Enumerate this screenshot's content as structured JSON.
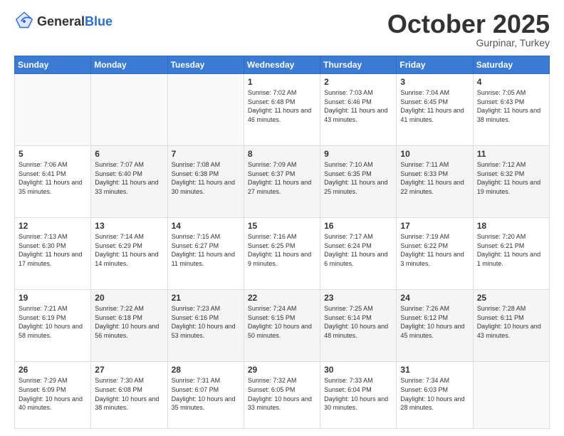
{
  "header": {
    "logo_general": "General",
    "logo_blue": "Blue",
    "month_title": "October 2025",
    "subtitle": "Gurpinar, Turkey"
  },
  "weekdays": [
    "Sunday",
    "Monday",
    "Tuesday",
    "Wednesday",
    "Thursday",
    "Friday",
    "Saturday"
  ],
  "weeks": [
    [
      {
        "day": "",
        "info": ""
      },
      {
        "day": "",
        "info": ""
      },
      {
        "day": "",
        "info": ""
      },
      {
        "day": "1",
        "info": "Sunrise: 7:02 AM\nSunset: 6:48 PM\nDaylight: 11 hours\nand 46 minutes."
      },
      {
        "day": "2",
        "info": "Sunrise: 7:03 AM\nSunset: 6:46 PM\nDaylight: 11 hours\nand 43 minutes."
      },
      {
        "day": "3",
        "info": "Sunrise: 7:04 AM\nSunset: 6:45 PM\nDaylight: 11 hours\nand 41 minutes."
      },
      {
        "day": "4",
        "info": "Sunrise: 7:05 AM\nSunset: 6:43 PM\nDaylight: 11 hours\nand 38 minutes."
      }
    ],
    [
      {
        "day": "5",
        "info": "Sunrise: 7:06 AM\nSunset: 6:41 PM\nDaylight: 11 hours\nand 35 minutes."
      },
      {
        "day": "6",
        "info": "Sunrise: 7:07 AM\nSunset: 6:40 PM\nDaylight: 11 hours\nand 33 minutes."
      },
      {
        "day": "7",
        "info": "Sunrise: 7:08 AM\nSunset: 6:38 PM\nDaylight: 11 hours\nand 30 minutes."
      },
      {
        "day": "8",
        "info": "Sunrise: 7:09 AM\nSunset: 6:37 PM\nDaylight: 11 hours\nand 27 minutes."
      },
      {
        "day": "9",
        "info": "Sunrise: 7:10 AM\nSunset: 6:35 PM\nDaylight: 11 hours\nand 25 minutes."
      },
      {
        "day": "10",
        "info": "Sunrise: 7:11 AM\nSunset: 6:33 PM\nDaylight: 11 hours\nand 22 minutes."
      },
      {
        "day": "11",
        "info": "Sunrise: 7:12 AM\nSunset: 6:32 PM\nDaylight: 11 hours\nand 19 minutes."
      }
    ],
    [
      {
        "day": "12",
        "info": "Sunrise: 7:13 AM\nSunset: 6:30 PM\nDaylight: 11 hours\nand 17 minutes."
      },
      {
        "day": "13",
        "info": "Sunrise: 7:14 AM\nSunset: 6:29 PM\nDaylight: 11 hours\nand 14 minutes."
      },
      {
        "day": "14",
        "info": "Sunrise: 7:15 AM\nSunset: 6:27 PM\nDaylight: 11 hours\nand 11 minutes."
      },
      {
        "day": "15",
        "info": "Sunrise: 7:16 AM\nSunset: 6:25 PM\nDaylight: 11 hours\nand 9 minutes."
      },
      {
        "day": "16",
        "info": "Sunrise: 7:17 AM\nSunset: 6:24 PM\nDaylight: 11 hours\nand 6 minutes."
      },
      {
        "day": "17",
        "info": "Sunrise: 7:19 AM\nSunset: 6:22 PM\nDaylight: 11 hours\nand 3 minutes."
      },
      {
        "day": "18",
        "info": "Sunrise: 7:20 AM\nSunset: 6:21 PM\nDaylight: 11 hours\nand 1 minute."
      }
    ],
    [
      {
        "day": "19",
        "info": "Sunrise: 7:21 AM\nSunset: 6:19 PM\nDaylight: 10 hours\nand 58 minutes."
      },
      {
        "day": "20",
        "info": "Sunrise: 7:22 AM\nSunset: 6:18 PM\nDaylight: 10 hours\nand 56 minutes."
      },
      {
        "day": "21",
        "info": "Sunrise: 7:23 AM\nSunset: 6:16 PM\nDaylight: 10 hours\nand 53 minutes."
      },
      {
        "day": "22",
        "info": "Sunrise: 7:24 AM\nSunset: 6:15 PM\nDaylight: 10 hours\nand 50 minutes."
      },
      {
        "day": "23",
        "info": "Sunrise: 7:25 AM\nSunset: 6:14 PM\nDaylight: 10 hours\nand 48 minutes."
      },
      {
        "day": "24",
        "info": "Sunrise: 7:26 AM\nSunset: 6:12 PM\nDaylight: 10 hours\nand 45 minutes."
      },
      {
        "day": "25",
        "info": "Sunrise: 7:28 AM\nSunset: 6:11 PM\nDaylight: 10 hours\nand 43 minutes."
      }
    ],
    [
      {
        "day": "26",
        "info": "Sunrise: 7:29 AM\nSunset: 6:09 PM\nDaylight: 10 hours\nand 40 minutes."
      },
      {
        "day": "27",
        "info": "Sunrise: 7:30 AM\nSunset: 6:08 PM\nDaylight: 10 hours\nand 38 minutes."
      },
      {
        "day": "28",
        "info": "Sunrise: 7:31 AM\nSunset: 6:07 PM\nDaylight: 10 hours\nand 35 minutes."
      },
      {
        "day": "29",
        "info": "Sunrise: 7:32 AM\nSunset: 6:05 PM\nDaylight: 10 hours\nand 33 minutes."
      },
      {
        "day": "30",
        "info": "Sunrise: 7:33 AM\nSunset: 6:04 PM\nDaylight: 10 hours\nand 30 minutes."
      },
      {
        "day": "31",
        "info": "Sunrise: 7:34 AM\nSunset: 6:03 PM\nDaylight: 10 hours\nand 28 minutes."
      },
      {
        "day": "",
        "info": ""
      }
    ]
  ]
}
